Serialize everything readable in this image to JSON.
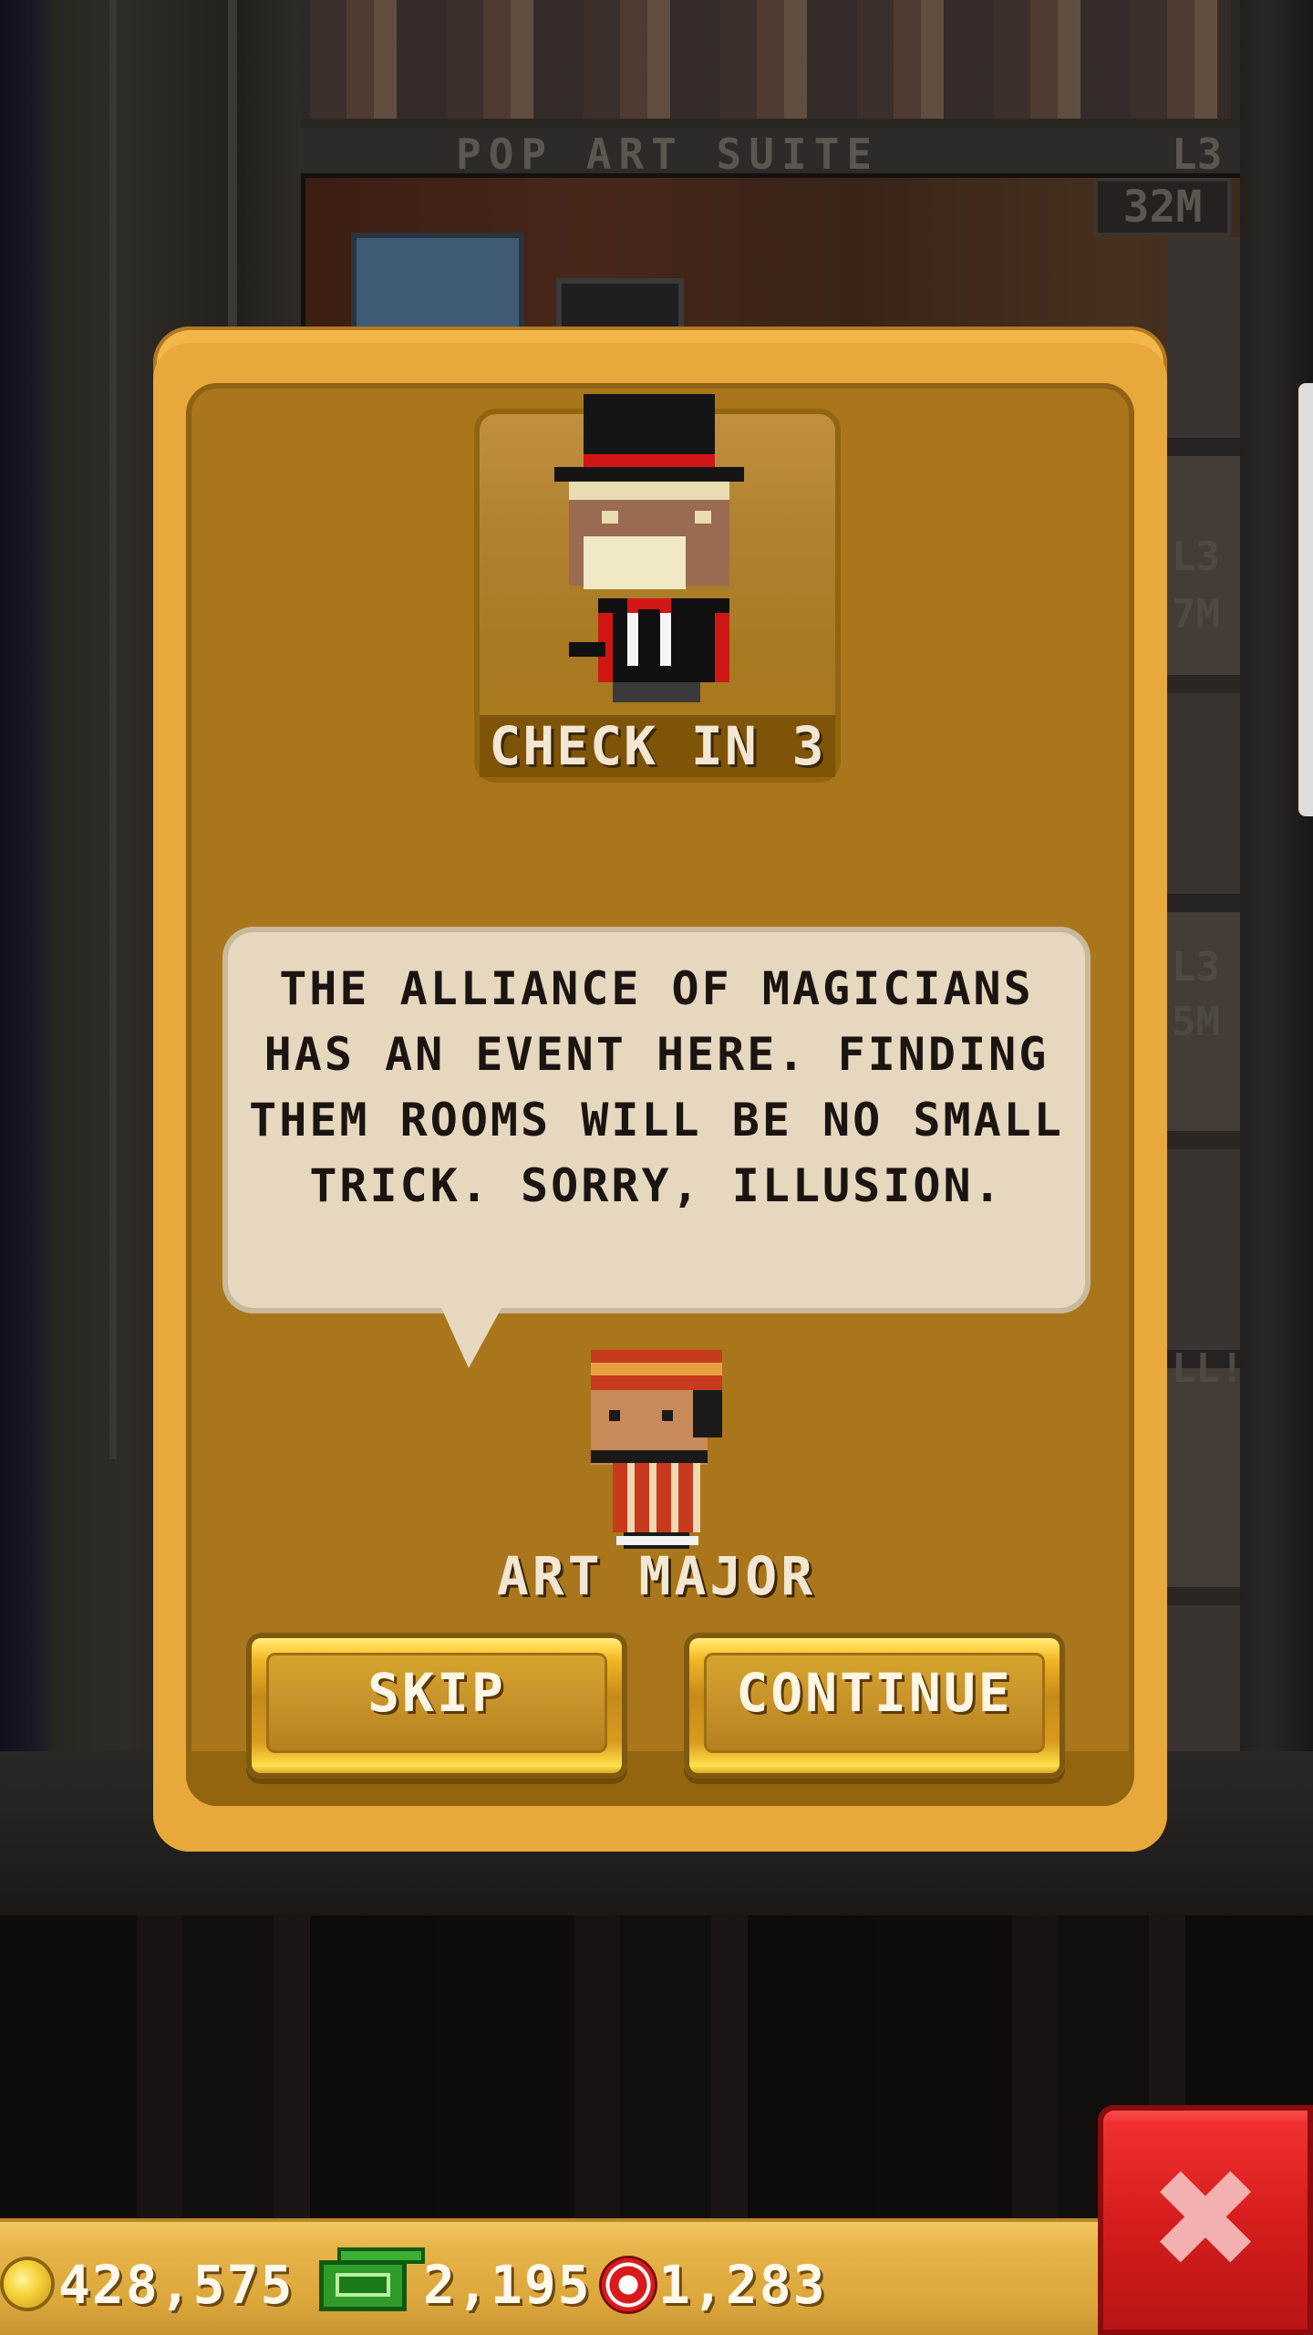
{
  "background": {
    "floor_name": "POP ART SUITE",
    "floor_level": "L3",
    "floor_cost": "32M",
    "right_tags": [
      "L3",
      "7M",
      "L3",
      "5M",
      "LL!"
    ]
  },
  "dialog": {
    "portrait_caption": "CHECK IN 3",
    "message": "THE ALLIANCE OF MAGICIANS HAS AN EVENT HERE. FINDING THEM ROOMS WILL BE NO SMALL TRICK. SORRY, ILLUSION.",
    "speaker_name": "ART MAJOR",
    "skip_label": "SKIP",
    "continue_label": "CONTINUE"
  },
  "currencies": {
    "coins": "428,575",
    "bux": "2,195",
    "chips": "1,283"
  },
  "icons": {
    "close": "close-icon",
    "coin": "coin-icon",
    "cash": "tower-bux-icon",
    "chip": "chip-icon"
  },
  "colors": {
    "dialog_frame": "#f3b64a",
    "dialog_panel": "#a9761b",
    "bubble": "#e5d8bf",
    "button_gold": "#f2b526",
    "close_red": "#d81e1e"
  }
}
